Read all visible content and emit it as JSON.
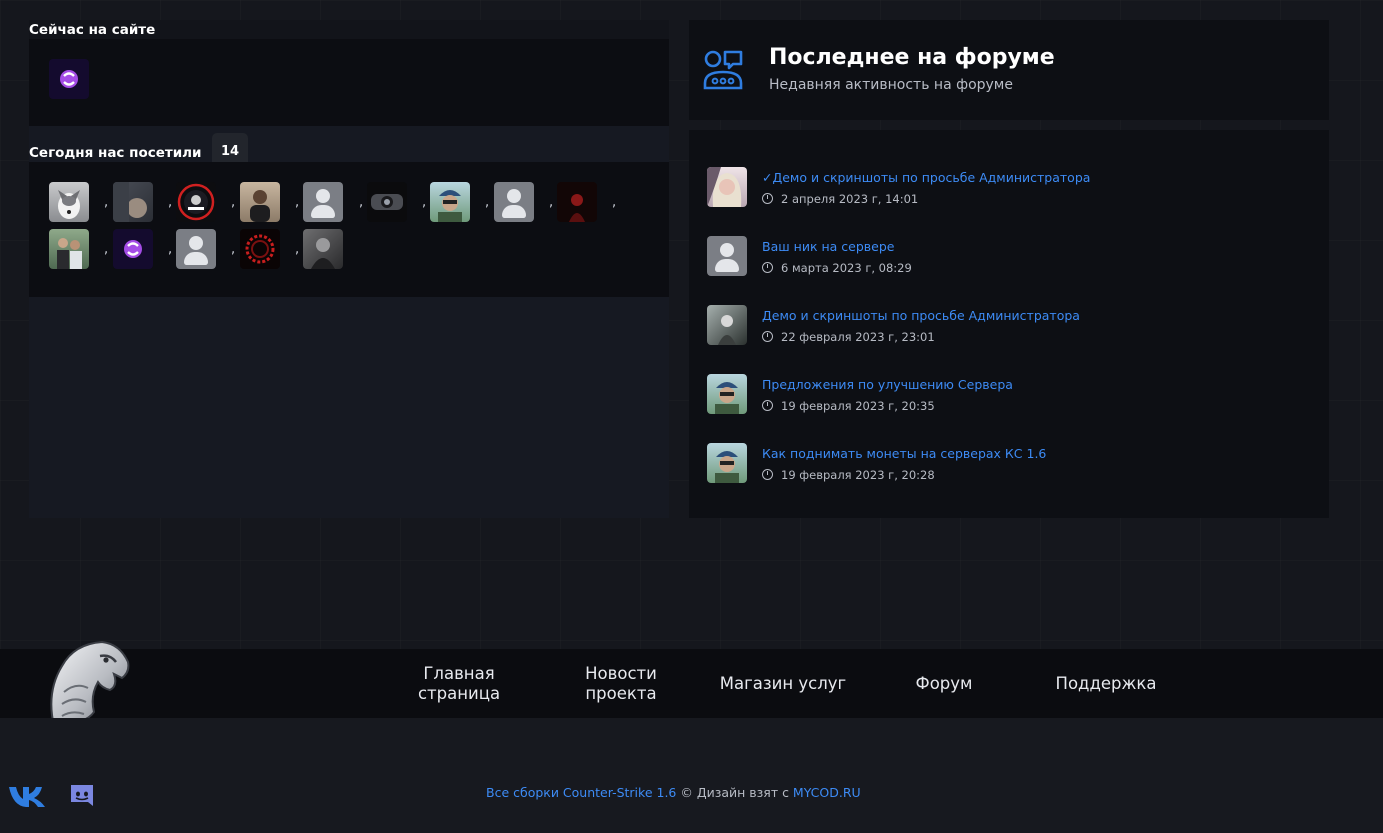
{
  "online": {
    "title": "Сейчас на сайте"
  },
  "visitors": {
    "title": "Сегодня нас посетили",
    "count": "14",
    "separator": ","
  },
  "forum": {
    "title": "Последнее на форуме",
    "subtitle": "Недавняя активность на форуме",
    "posts": [
      {
        "title": "✓Демо и скриншоты по просьбе Администратора",
        "date": "2 апреля 2023 г, 14:01"
      },
      {
        "title": "Ваш ник на сервере",
        "date": "6 марта 2023 г, 08:29"
      },
      {
        "title": "Демо и скриншоты по просьбе Администратора",
        "date": "22 февраля 2023 г, 23:01"
      },
      {
        "title": "Предложения по улучшению Сервера",
        "date": "19 февраля 2023 г, 20:35"
      },
      {
        "title": "Как поднимать монеты на серверах КС 1.6",
        "date": "19 февраля 2023 г, 20:28"
      }
    ]
  },
  "nav": {
    "home": "Главная страница",
    "news": "Новости проекта",
    "shop": "Магазин услуг",
    "forum": "Форум",
    "support": "Поддержка"
  },
  "footer": {
    "link1": "Все сборки Counter-Strike 1.6",
    "middle": " © Дизайн взят с ",
    "link2": "MYCOD.RU"
  },
  "colors": {
    "accent": "#3d8bf5",
    "icon": "#2f7de0",
    "discord": "#7b87e0"
  }
}
